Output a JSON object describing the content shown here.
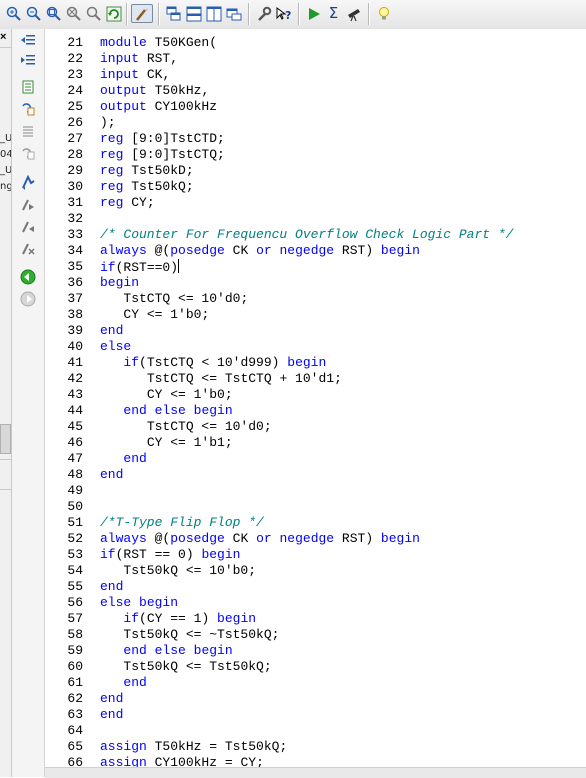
{
  "toolbar": {
    "icons": [
      "zoom-in-icon",
      "zoom-out-icon",
      "zoom-fit-icon",
      "zoom-full-icon",
      "zoom-select-icon",
      "refresh-icon",
      "select-icon",
      "cascade-icon",
      "tile-horizontal-icon",
      "tile-vertical-icon",
      "window-arrange-icon",
      "settings-wrench-icon",
      "context-help-icon",
      "run-icon",
      "sum-icon",
      "telescope-icon",
      "lightbulb-icon"
    ]
  },
  "project_panel": {
    "close_label": "×",
    "fragments": [
      "_U",
      "04",
      "_U",
      "ng"
    ]
  },
  "code_lines": [
    {
      "n": "21",
      "t": "module T50KGen("
    },
    {
      "n": "22",
      "t": "input RST,"
    },
    {
      "n": "23",
      "t": "input CK,"
    },
    {
      "n": "24",
      "t": "output T50kHz,"
    },
    {
      "n": "25",
      "t": "output CY100kHz"
    },
    {
      "n": "26",
      "t": ");"
    },
    {
      "n": "27",
      "t": "reg [9:0]TstCTD;"
    },
    {
      "n": "28",
      "t": "reg [9:0]TstCTQ;"
    },
    {
      "n": "29",
      "t": "reg Tst50kD;"
    },
    {
      "n": "30",
      "t": "reg Tst50kQ;"
    },
    {
      "n": "31",
      "t": "reg CY;"
    },
    {
      "n": "32",
      "t": ""
    },
    {
      "n": "33",
      "t": "/* Counter For Frequencu Overflow Check Logic Part */"
    },
    {
      "n": "34",
      "t": "always @(posedge CK or negedge RST) begin"
    },
    {
      "n": "35",
      "t": "if(RST==0)"
    },
    {
      "n": "36",
      "t": "begin"
    },
    {
      "n": "37",
      "t": "   TstCTQ <= 10'd0;"
    },
    {
      "n": "38",
      "t": "   CY <= 1'b0;"
    },
    {
      "n": "39",
      "t": "end"
    },
    {
      "n": "40",
      "t": "else"
    },
    {
      "n": "41",
      "t": "   if(TstCTQ < 10'd999) begin"
    },
    {
      "n": "42",
      "t": "      TstCTQ <= TstCTQ + 10'd1;"
    },
    {
      "n": "43",
      "t": "      CY <= 1'b0;"
    },
    {
      "n": "44",
      "t": "   end else begin"
    },
    {
      "n": "45",
      "t": "      TstCTQ <= 10'd0;"
    },
    {
      "n": "46",
      "t": "      CY <= 1'b1;"
    },
    {
      "n": "47",
      "t": "   end"
    },
    {
      "n": "48",
      "t": "end"
    },
    {
      "n": "49",
      "t": ""
    },
    {
      "n": "50",
      "t": ""
    },
    {
      "n": "51",
      "t": "/*T-Type Flip Flop */"
    },
    {
      "n": "52",
      "t": "always @(posedge CK or negedge RST) begin"
    },
    {
      "n": "53",
      "t": "if(RST == 0) begin"
    },
    {
      "n": "54",
      "t": "   Tst50kQ <= 10'b0;"
    },
    {
      "n": "55",
      "t": "end"
    },
    {
      "n": "56",
      "t": "else begin"
    },
    {
      "n": "57",
      "t": "   if(CY == 1) begin"
    },
    {
      "n": "58",
      "t": "   Tst50kQ <= ~Tst50kQ;"
    },
    {
      "n": "59",
      "t": "   end else begin"
    },
    {
      "n": "60",
      "t": "   Tst50kQ <= Tst50kQ;"
    },
    {
      "n": "61",
      "t": "   end"
    },
    {
      "n": "62",
      "t": "end"
    },
    {
      "n": "63",
      "t": "end"
    },
    {
      "n": "64",
      "t": ""
    },
    {
      "n": "65",
      "t": "assign T50kHz = Tst50kQ;"
    },
    {
      "n": "66",
      "t": "assign CY100kHz = CY;"
    }
  ],
  "keywords": [
    "module",
    "input",
    "output",
    "reg",
    "always",
    "posedge",
    "negedge",
    "or",
    "begin",
    "end",
    "if",
    "else",
    "assign"
  ],
  "colors": {
    "keyword": "#0000ff",
    "comment": "#008080",
    "text": "#000000"
  },
  "caret_line": "35"
}
